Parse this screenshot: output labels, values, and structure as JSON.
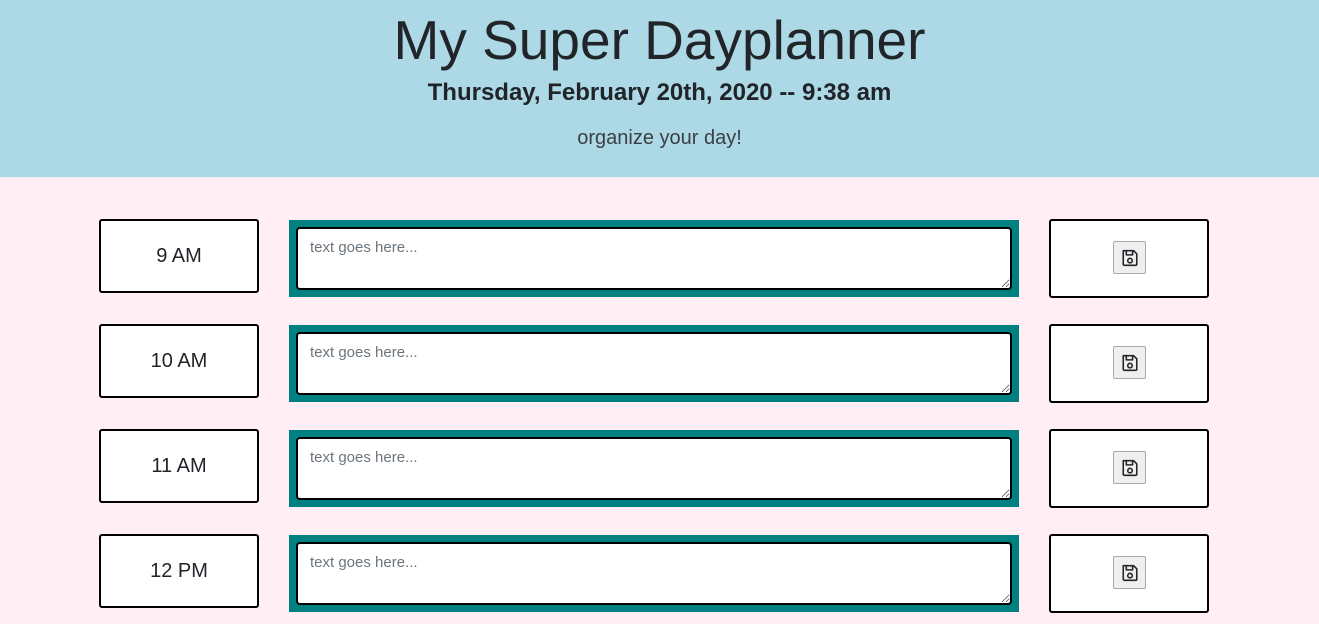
{
  "header": {
    "title": "My Super Dayplanner",
    "date": "Thursday, February 20th, 2020 -- 9:38 am",
    "tagline": "organize your day!"
  },
  "rows": [
    {
      "hour": "9 AM",
      "placeholder": "text goes here...",
      "value": "",
      "save_icon": "floppy-disk-icon"
    },
    {
      "hour": "10 AM",
      "placeholder": "text goes here...",
      "value": "",
      "save_icon": "floppy-disk-icon"
    },
    {
      "hour": "11 AM",
      "placeholder": "text goes here...",
      "value": "",
      "save_icon": "floppy-disk-icon"
    },
    {
      "hour": "12 PM",
      "placeholder": "text goes here...",
      "value": "",
      "save_icon": "floppy-disk-icon"
    }
  ],
  "colors": {
    "header_background": "#add8e6",
    "page_background": "#ffeff4",
    "textarea_frame": "#008080"
  }
}
